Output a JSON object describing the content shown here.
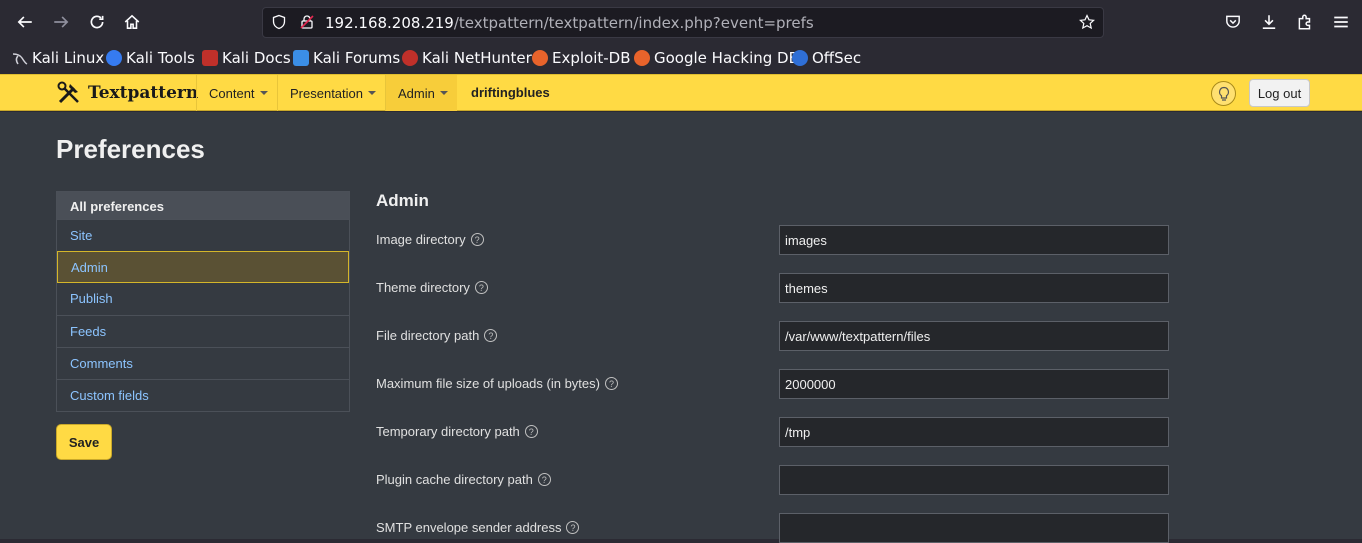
{
  "browser": {
    "url_host": "192.168.208.219",
    "url_path": "/textpattern/textpattern/index.php?event=prefs",
    "bookmarks": [
      {
        "label": "Kali Linux",
        "color": "#367bf0"
      },
      {
        "label": "Kali Tools",
        "color": "#e8413a"
      },
      {
        "label": "Kali Docs",
        "color": "#c0302a"
      },
      {
        "label": "Kali Forums",
        "color": "#3b8ee6"
      },
      {
        "label": "Kali NetHunter",
        "color": "#c0302a"
      },
      {
        "label": "Exploit-DB",
        "color": "#e8632b"
      },
      {
        "label": "Google Hacking DB",
        "color": "#e8632b"
      },
      {
        "label": "OffSec",
        "color": "#2f6fd6"
      }
    ]
  },
  "header": {
    "logo": "Textpattern",
    "nav": {
      "content": "Content",
      "presentation": "Presentation",
      "admin": "Admin"
    },
    "site_name": "driftingblues",
    "logout": "Log out"
  },
  "page": {
    "title": "Preferences",
    "sidebar": {
      "heading": "All preferences",
      "items": [
        "Site",
        "Admin",
        "Publish",
        "Feeds",
        "Comments",
        "Custom fields"
      ],
      "active": "Admin"
    },
    "save": "Save",
    "section": "Admin",
    "fields": [
      {
        "label": "Image directory",
        "value": "images"
      },
      {
        "label": "Theme directory",
        "value": "themes"
      },
      {
        "label": "File directory path",
        "value": "/var/www/textpattern/files"
      },
      {
        "label": "Maximum file size of uploads (in bytes)",
        "value": "2000000"
      },
      {
        "label": "Temporary directory path",
        "value": "/tmp"
      },
      {
        "label": "Plugin cache directory path",
        "value": ""
      },
      {
        "label": "SMTP envelope sender address",
        "value": ""
      }
    ]
  }
}
